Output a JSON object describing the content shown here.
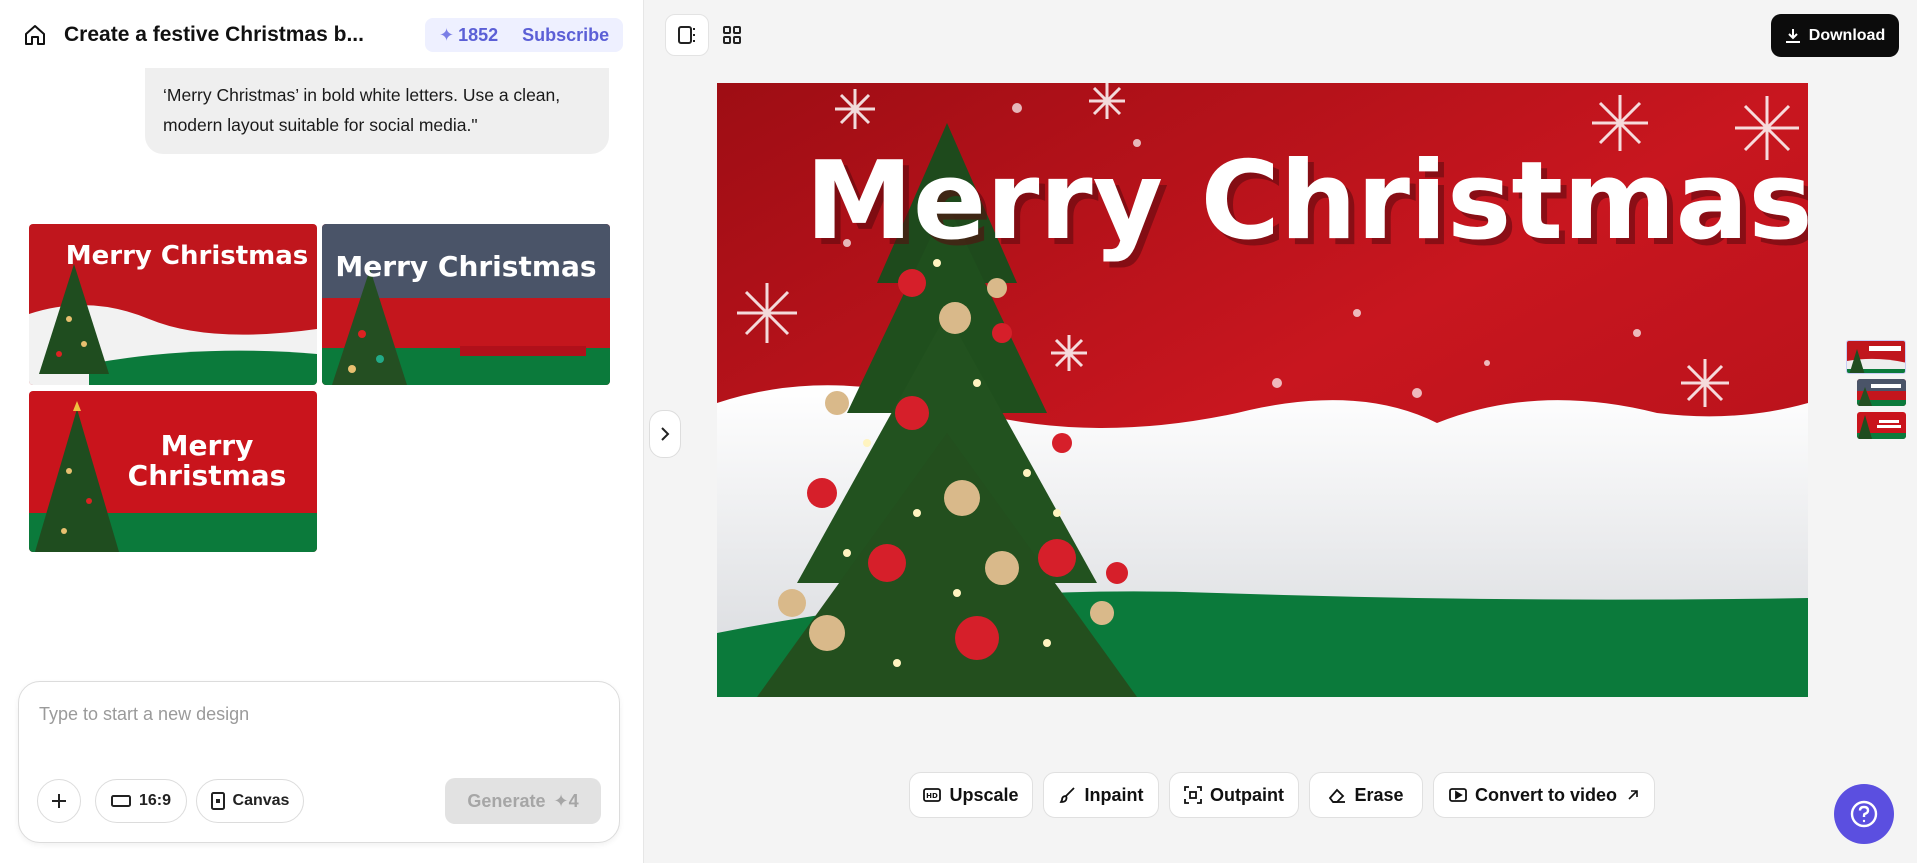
{
  "header": {
    "title": "Create a festive Christmas b...",
    "credits": "1852",
    "subscribe_label": "Subscribe"
  },
  "chat": {
    "prompt_line1": "‘Merry Christmas’ in bold white letters. Use a clean,",
    "prompt_line2": "modern layout suitable for social media.\""
  },
  "results": {
    "image_text_1": "Merry Christmas",
    "image_text_2": "Merry Christmas",
    "image_text_3a": "Merry",
    "image_text_3b": "Christmas"
  },
  "composer": {
    "placeholder": "Type to start a new design",
    "aspect_label": "16:9",
    "canvas_label": "Canvas",
    "generate_label": "Generate",
    "generate_cost": "4"
  },
  "toolbar": {
    "download_label": "Download"
  },
  "preview": {
    "headline": "Merry Christmas"
  },
  "actions": {
    "upscale": "Upscale",
    "inpaint": "Inpaint",
    "outpaint": "Outpaint",
    "erase": "Erase",
    "convert": "Convert to video"
  },
  "colors": {
    "accent": "#5b4fe0",
    "red": "#c0161d",
    "green": "#0b7a3b"
  }
}
